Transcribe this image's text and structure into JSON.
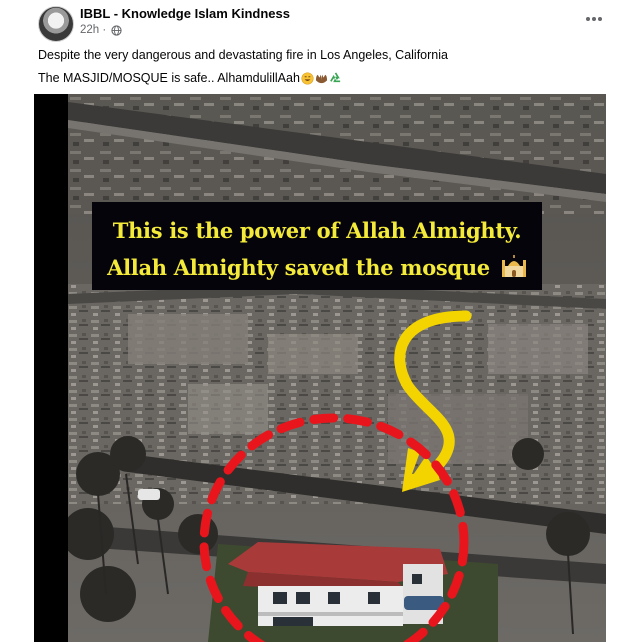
{
  "post": {
    "page_name": "IBBL - Knowledge Islam Kindness",
    "time": "22h",
    "separator": "·",
    "privacy_icon": "globe-icon",
    "more_icon": "more-horizontal-icon",
    "text_line_1": "Despite the very dangerous and devastating fire in Los Angeles, California",
    "text_line_2": "The MASJID/MOSQUE is safe.. AlhamdulillAah",
    "text_emojis": [
      "smiling-face-emoji",
      "palms-up-emoji",
      "recycle-emoji"
    ]
  },
  "media": {
    "caption_line_1": "This is the power of Allah Almighty.",
    "caption_line_2": "Allah Almighty saved the mosque",
    "caption_emoji": "mosque-emoji",
    "annotations": [
      "yellow-arrow",
      "red-dashed-circle"
    ],
    "colors": {
      "caption_text": "#f4ea3a",
      "caption_bg": "#05040a",
      "arrow": "#f3d400",
      "circle": "#e8161c",
      "roof": "#a83a3a"
    }
  }
}
